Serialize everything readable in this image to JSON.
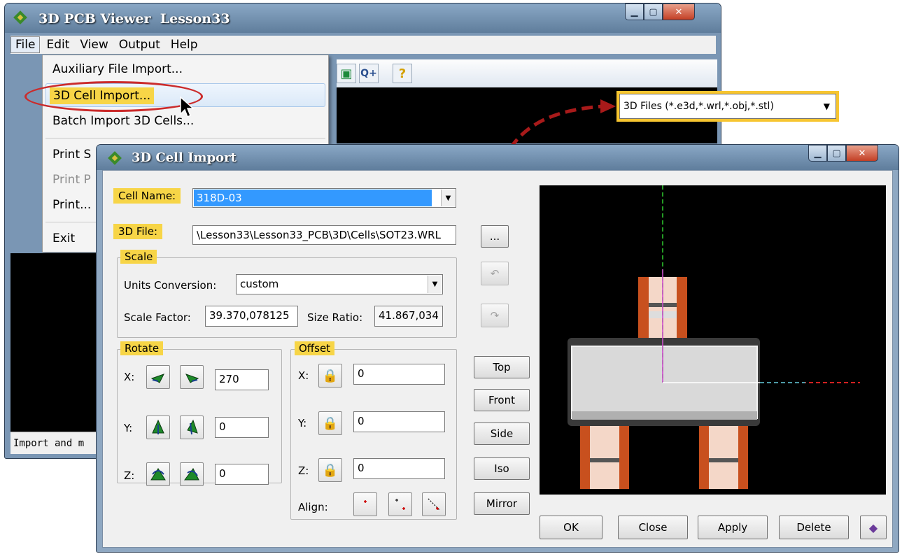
{
  "main_window": {
    "title": "3D PCB Viewer  Lesson33",
    "menu": [
      "File",
      "Edit",
      "View",
      "Output",
      "Help"
    ],
    "status_text": "Import and m"
  },
  "file_menu": {
    "items": [
      {
        "label": "Auxiliary File Import...",
        "disabled": false
      },
      {
        "label": "3D Cell Import...",
        "disabled": false
      },
      {
        "label": "Batch Import 3D Cells...",
        "disabled": false
      },
      {
        "label": "Print S",
        "disabled": false
      },
      {
        "label": "Print P",
        "disabled": true
      },
      {
        "label": "Print...",
        "disabled": false
      },
      {
        "label": "Exit",
        "disabled": false
      }
    ]
  },
  "filter_dropdown": {
    "value": "3D Files (*.e3d,*.wrl,*.obj,*.stl)"
  },
  "dialog": {
    "title": "3D Cell Import",
    "cell_name_label": "Cell Name:",
    "cell_name_value": "318D-03",
    "file_label": "3D File:",
    "file_value": "\\Lesson33\\Lesson33_PCB\\3D\\Cells\\SOT23.WRL",
    "browse_label": "...",
    "scale": {
      "title": "Scale",
      "units_label": "Units Conversion:",
      "units_value": "custom",
      "factor_label": "Scale Factor:",
      "factor_value": "39.370,078125",
      "ratio_label": "Size Ratio:",
      "ratio_value": "41.867,034"
    },
    "rotate": {
      "title": "Rotate",
      "x_label": "X:",
      "x_value": "270",
      "y_label": "Y:",
      "y_value": "0",
      "z_label": "Z:",
      "z_value": "0"
    },
    "offset": {
      "title": "Offset",
      "x_label": "X:",
      "x_value": "0",
      "y_label": "Y:",
      "y_value": "0",
      "z_label": "Z:",
      "z_value": "0",
      "align_label": "Align:"
    },
    "view_buttons": [
      "Top",
      "Front",
      "Side",
      "Iso",
      "Mirror"
    ],
    "bottom_buttons": [
      "OK",
      "Close",
      "Apply",
      "Delete"
    ]
  },
  "colors": {
    "highlight": "#f7d547",
    "annotation_red": "#cb2b2b",
    "selection_blue": "#3399ff",
    "pad_orange": "#c8501e"
  }
}
